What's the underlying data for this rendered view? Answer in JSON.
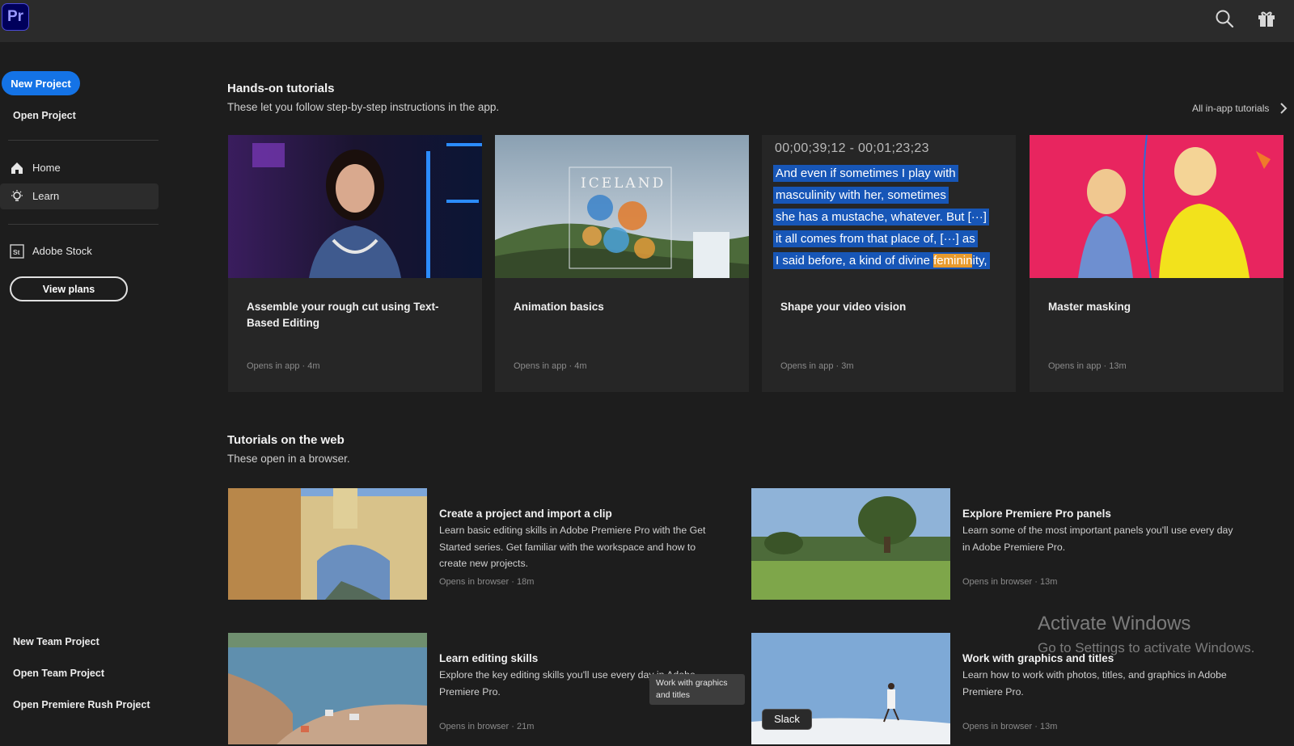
{
  "app": {
    "logo_text": "Pr"
  },
  "topbar": {
    "icons": [
      "search-icon",
      "gift-icon"
    ]
  },
  "sidebar": {
    "new_project": "New Project",
    "open_project": "Open Project",
    "nav": [
      {
        "label": "Home",
        "icon": "home-icon",
        "active": false
      },
      {
        "label": "Learn",
        "icon": "lightbulb-icon",
        "active": true
      },
      {
        "label": "Adobe Stock",
        "icon": "stock-icon",
        "active": false
      }
    ],
    "stock_icon_text": "St",
    "view_plans": "View plans",
    "bottom_links": [
      "New Team Project",
      "Open Team Project",
      "Open Premiere Rush Project"
    ]
  },
  "hands_on": {
    "title": "Hands-on tutorials",
    "subtitle": "These let you follow step-by-step instructions in the app.",
    "all_link": "All in-app tutorials",
    "cards": [
      {
        "title": "Assemble your rough cut using Text-Based Editing",
        "meta": "Opens in app · 4m"
      },
      {
        "title": "Animation basics",
        "meta": "Opens in app · 4m",
        "thumb_text": "ICELAND"
      },
      {
        "title": "Shape your video vision",
        "meta": "Opens in app · 3m"
      },
      {
        "title": "Master masking",
        "meta": "Opens in app · 13m"
      }
    ],
    "transcript": {
      "timecode": "00;00;39;12 - 00;01;23;23",
      "lines": [
        "And even if sometimes I play with",
        "masculinity with her, sometimes",
        "she has a mustache, whatever. But [···]",
        "it all comes from that place of, [···] as"
      ],
      "last_before": "I said before, a kind of divine ",
      "last_highlight": "feminin",
      "last_after": "ity,"
    }
  },
  "web": {
    "title": "Tutorials on the web",
    "subtitle": "These open in a browser.",
    "items": [
      {
        "title": "Create a project and import a clip",
        "desc": "Learn basic editing skills in Adobe Premiere Pro with the Get Started series. Get familiar with the workspace and how to create new projects.",
        "meta": "Opens in browser · 18m"
      },
      {
        "title": "Explore Premiere Pro panels",
        "desc": "Learn some of the most important panels you'll use every day in Adobe Premiere Pro.",
        "meta": "Opens in browser · 13m"
      },
      {
        "title": "Learn editing skills",
        "desc": "Explore the key editing skills you'll use every day in Adobe Premiere Pro.",
        "meta": "Opens in browser · 21m"
      },
      {
        "title": "Work with graphics and titles",
        "desc": "Learn how to work with photos, titles, and graphics in Adobe Premiere Pro.",
        "meta": "Opens in browser · 13m"
      }
    ]
  },
  "tooltip": "Work with graphics and titles",
  "slack_tooltip": "Slack",
  "activate": {
    "line1": "Activate Windows",
    "line2": "Go to Settings to activate Windows."
  }
}
